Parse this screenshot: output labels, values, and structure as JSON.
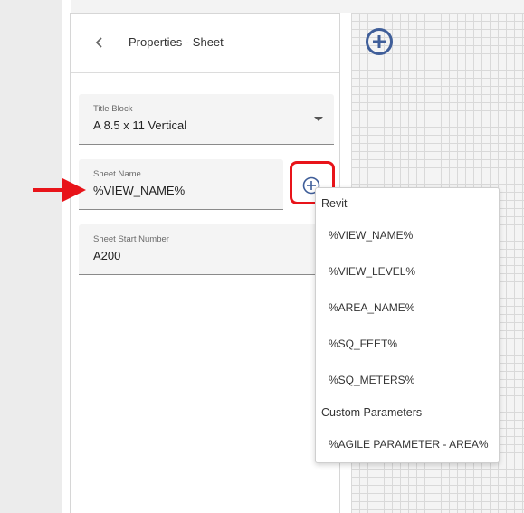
{
  "panel": {
    "title": "Properties - Sheet"
  },
  "fields": {
    "title_block": {
      "label": "Title Block",
      "value": "A 8.5 x 11 Vertical"
    },
    "sheet_name": {
      "label": "Sheet Name",
      "value": "%VIEW_NAME%"
    },
    "sheet_start_number": {
      "label": "Sheet Start Number",
      "value": "A200"
    }
  },
  "menu": {
    "sections": [
      {
        "title": "Revit",
        "items": [
          "%VIEW_NAME%",
          "%VIEW_LEVEL%",
          "%AREA_NAME%",
          "%SQ_FEET%",
          "%SQ_METERS%"
        ]
      },
      {
        "title": "Custom Parameters",
        "items": [
          "%AGILE PARAMETER - AREA%"
        ]
      }
    ]
  },
  "colors": {
    "accent": "#3f5e99",
    "highlight_red": "#e8141a"
  },
  "icons": {
    "back": "chevron-left-icon",
    "add": "plus-circle-icon",
    "dropdown": "caret-down-icon",
    "pointer": "arrow-right-icon"
  }
}
